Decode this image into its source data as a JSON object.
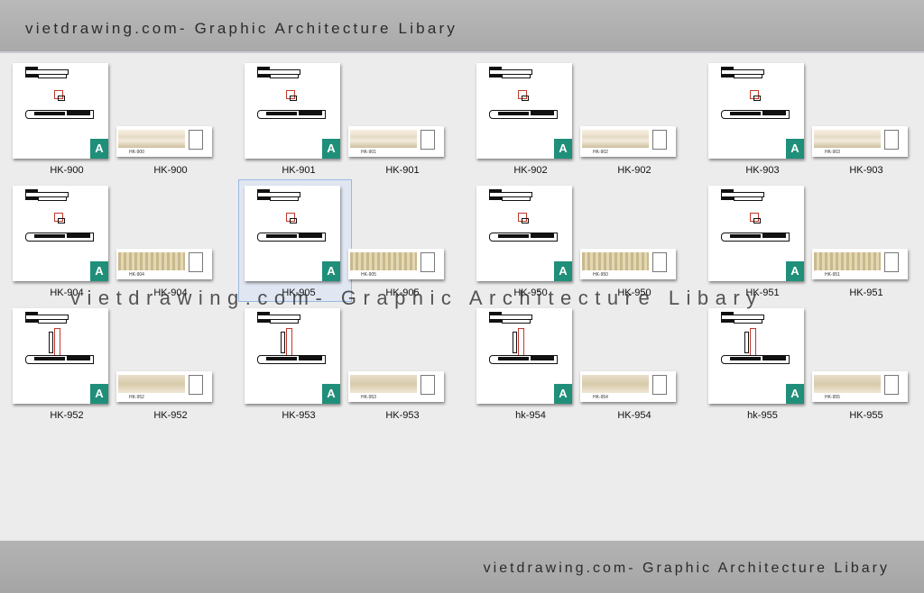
{
  "header": {
    "title": "vietdrawing.com- Graphic Architecture Libary"
  },
  "footer": {
    "title": "vietdrawing.com- Graphic Architecture Libary"
  },
  "watermark": {
    "text": "vietdrawing.com- Graphic Architecture Libary"
  },
  "files": [
    {
      "caption": "HK-900",
      "kind": "dwg"
    },
    {
      "caption": "HK-900",
      "kind": "image",
      "label": "HK-900"
    },
    {
      "caption": "HK-901",
      "kind": "dwg"
    },
    {
      "caption": "HK-901",
      "kind": "image",
      "label": "HK-901"
    },
    {
      "caption": "HK-902",
      "kind": "dwg"
    },
    {
      "caption": "HK-902",
      "kind": "image",
      "label": "HK-902"
    },
    {
      "caption": "HK-903",
      "kind": "dwg"
    },
    {
      "caption": "HK-903",
      "kind": "image",
      "label": "HK-903"
    },
    {
      "caption": "HK-904",
      "kind": "dwg"
    },
    {
      "caption": "HK-904",
      "kind": "image",
      "label": "HK-904"
    },
    {
      "caption": "HK-905",
      "kind": "dwg",
      "selected": true
    },
    {
      "caption": "HK-905",
      "kind": "image",
      "label": "HK-905"
    },
    {
      "caption": "HK-950",
      "kind": "dwg"
    },
    {
      "caption": "HK-950",
      "kind": "image",
      "label": "HK-950"
    },
    {
      "caption": "HK-951",
      "kind": "dwg"
    },
    {
      "caption": "HK-951",
      "kind": "image",
      "label": "HK-951"
    },
    {
      "caption": "HK-952",
      "kind": "dwg"
    },
    {
      "caption": "HK-952",
      "kind": "image",
      "label": "HK-952"
    },
    {
      "caption": "HK-953",
      "kind": "dwg"
    },
    {
      "caption": "HK-953",
      "kind": "image",
      "label": "HK-953"
    },
    {
      "caption": "hk-954",
      "kind": "dwg"
    },
    {
      "caption": "HK-954",
      "kind": "image",
      "label": "HK-954"
    },
    {
      "caption": "hk-955",
      "kind": "dwg"
    },
    {
      "caption": "HK-955",
      "kind": "image",
      "label": "HK-955"
    }
  ],
  "icons": {
    "cad_badge": "autocad-file-icon"
  },
  "colors": {
    "accent": "#1f8f7a",
    "profile_red": "#c0392b"
  }
}
